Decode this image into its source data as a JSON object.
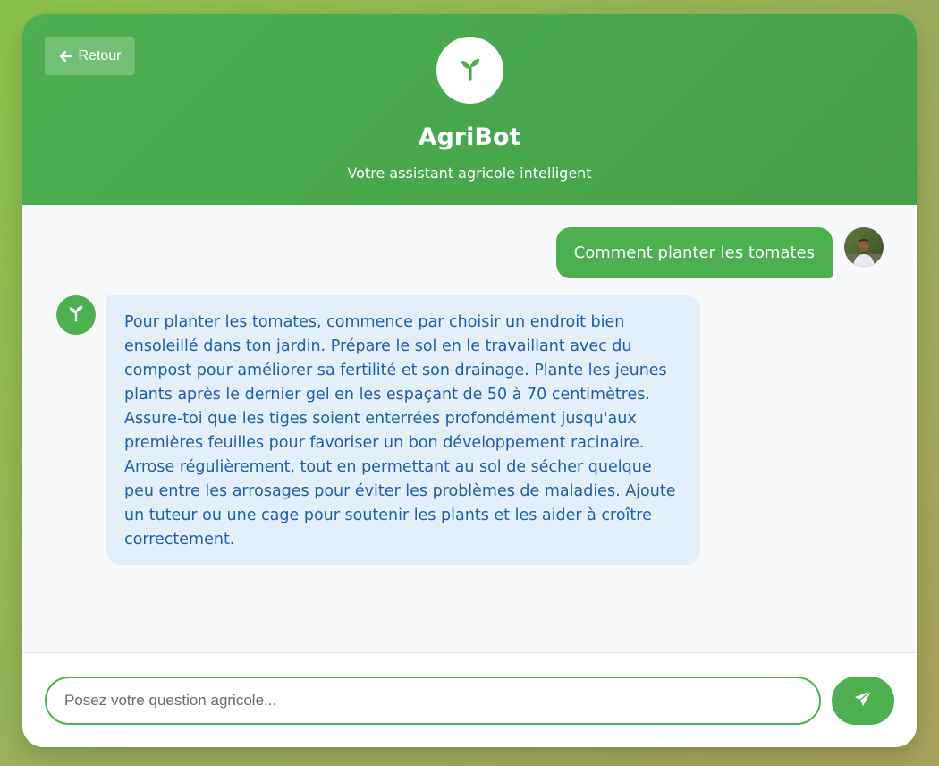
{
  "header": {
    "back_label": "Retour",
    "back_icon": "arrow-left-icon",
    "logo_icon": "seedling-icon",
    "title": "AgriBot",
    "subtitle": "Votre assistant agricole intelligent"
  },
  "messages": [
    {
      "role": "user",
      "text": "Comment planter les tomates",
      "avatar": "user-avatar-photo"
    },
    {
      "role": "bot",
      "avatar_icon": "seedling-icon",
      "text": "Pour planter les tomates, commence par choisir un endroit bien ensoleillé dans ton jardin. Prépare le sol en le travaillant avec du compost pour améliorer sa fertilité et son drainage. Plante les jeunes plants après le dernier gel en les espaçant de 50 à 70 centimètres. Assure-toi que les tiges soient enterrées profondément jusqu'aux premières feuilles pour favoriser un bon développement racinaire. Arrose régulièrement, tout en permettant au sol de sécher quelque peu entre les arrosages pour éviter les problèmes de maladies. Ajoute un tuteur ou une cage pour soutenir les plants et les aider à croître correctement."
    }
  ],
  "composer": {
    "placeholder": "Posez votre question agricole...",
    "value": "",
    "send_icon": "paper-plane-icon"
  },
  "colors": {
    "primary_green": "#4caf50",
    "bot_bubble_bg": "#e3f0fb",
    "bot_text": "#1e5fa8",
    "chat_bg": "#f7f9fa"
  }
}
